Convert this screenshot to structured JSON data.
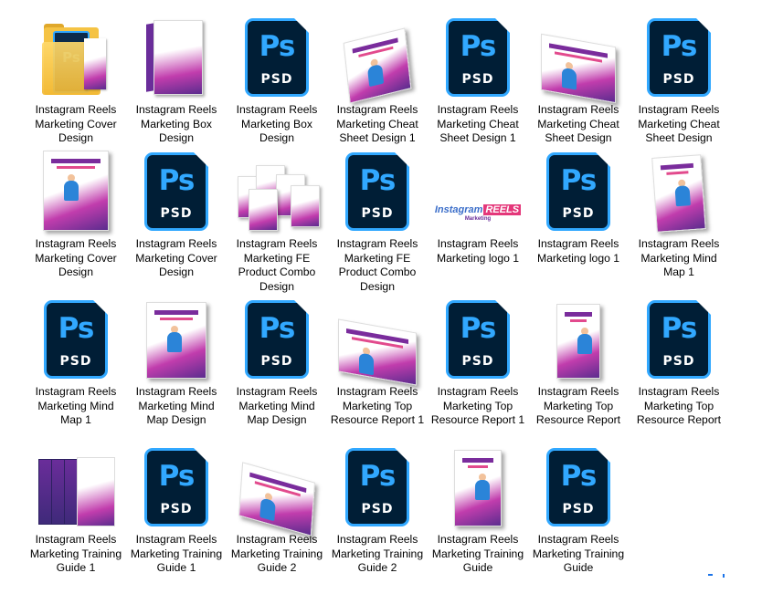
{
  "files": [
    {
      "label": "Instagram Reels Marketing Cover Design",
      "icon": "folder-icon"
    },
    {
      "label": "Instagram Reels Marketing Box Design",
      "icon": "box-mockup-thumbnail"
    },
    {
      "label": "Instagram Reels Marketing Box Design",
      "icon": "photoshop-file-icon",
      "ps": "Ps",
      "psd": "PSD"
    },
    {
      "label": "Instagram Reels Marketing Cheat Sheet Design 1",
      "icon": "cheat-sheet-thumbnail"
    },
    {
      "label": "Instagram Reels Marketing Cheat Sheet Design 1",
      "icon": "photoshop-file-icon",
      "ps": "Ps",
      "psd": "PSD"
    },
    {
      "label": "Instagram Reels Marketing Cheat Sheet Design",
      "icon": "cheat-sheet-thumbnail"
    },
    {
      "label": "Instagram Reels Marketing Cheat Sheet Design",
      "icon": "photoshop-file-icon",
      "ps": "Ps",
      "psd": "PSD"
    },
    {
      "label": "Instagram Reels Marketing Cover Design",
      "icon": "cover-thumbnail"
    },
    {
      "label": "Instagram Reels Marketing Cover Design",
      "icon": "photoshop-file-icon",
      "ps": "Ps",
      "psd": "PSD"
    },
    {
      "label": "Instagram Reels Marketing FE Product Combo Design",
      "icon": "combo-thumbnail"
    },
    {
      "label": "Instagram Reels Marketing FE Product Combo Design",
      "icon": "photoshop-file-icon",
      "ps": "Ps",
      "psd": "PSD"
    },
    {
      "label": "Instagram Reels Marketing logo 1",
      "icon": "logo-thumbnail",
      "logo": {
        "a": "Instagram",
        "b": "REELS",
        "c": "Marketing"
      }
    },
    {
      "label": "Instagram Reels Marketing logo 1",
      "icon": "photoshop-file-icon",
      "ps": "Ps",
      "psd": "PSD"
    },
    {
      "label": "Instagram Reels Marketing Mind Map 1",
      "icon": "mind-map-thumbnail"
    },
    {
      "label": "Instagram Reels Marketing Mind Map 1",
      "icon": "photoshop-file-icon",
      "ps": "Ps",
      "psd": "PSD"
    },
    {
      "label": "Instagram Reels Marketing Mind Map Design",
      "icon": "mind-map-thumbnail"
    },
    {
      "label": "Instagram Reels Marketing Mind Map Design",
      "icon": "photoshop-file-icon",
      "ps": "Ps",
      "psd": "PSD"
    },
    {
      "label": "Instagram Reels Marketing Top Resource Report 1",
      "icon": "report-thumbnail"
    },
    {
      "label": "Instagram Reels Marketing Top Resource Report 1",
      "icon": "photoshop-file-icon",
      "ps": "Ps",
      "psd": "PSD"
    },
    {
      "label": "Instagram Reels Marketing Top Resource Report",
      "icon": "report-thumbnail"
    },
    {
      "label": "Instagram Reels Marketing Top Resource Report",
      "icon": "photoshop-file-icon",
      "ps": "Ps",
      "psd": "PSD"
    },
    {
      "label": "Instagram Reels Marketing Training Guide 1",
      "icon": "training-guide-thumbnail"
    },
    {
      "label": "Instagram Reels Marketing Training Guide 1",
      "icon": "photoshop-file-icon",
      "ps": "Ps",
      "psd": "PSD"
    },
    {
      "label": "Instagram Reels Marketing Training Guide 2",
      "icon": "training-guide-thumbnail"
    },
    {
      "label": "Instagram Reels Marketing Training Guide 2",
      "icon": "photoshop-file-icon",
      "ps": "Ps",
      "psd": "PSD"
    },
    {
      "label": "Instagram Reels Marketing Training Guide",
      "icon": "training-guide-thumbnail"
    },
    {
      "label": "Instagram Reels Marketing Training Guide",
      "icon": "photoshop-file-icon",
      "ps": "Ps",
      "psd": "PSD"
    }
  ],
  "colors": {
    "ps_bg": "#001e36",
    "ps_accent": "#31a8ff",
    "brand_purple": "#6a2d9a",
    "brand_pink": "#e4377a"
  }
}
